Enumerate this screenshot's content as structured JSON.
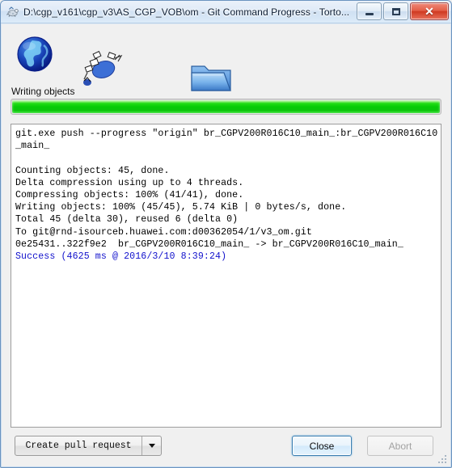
{
  "window": {
    "title": "D:\\cgp_v161\\cgp_v3\\AS_CGP_VOB\\om - Git Command Progress - Torto...",
    "app_icon": "tortoisegit-icon",
    "controls": {
      "minimize_label": "Minimize",
      "maximize_label": "Maximize",
      "close_label": "Close"
    }
  },
  "animation": {
    "source_icon": "globe-icon",
    "transfer_icon": "file-transfer-icon",
    "destination_icon": "folder-icon",
    "status_label": "Writing objects"
  },
  "progress": {
    "percent": 100,
    "fill_color": "#0bc40b",
    "track_color": "#e8e8e8"
  },
  "console": {
    "output": "git.exe push --progress \"origin\" br_CGPV200R016C10_main_:br_CGPV200R016C10_main_\n\nCounting objects: 45, done.\nDelta compression using up to 4 threads.\nCompressing objects: 100% (41/41), done.\nWriting objects: 100% (45/45), 5.74 KiB | 0 bytes/s, done.\nTotal 45 (delta 30), reused 6 (delta 0)\nTo git@rnd-isourceb.huawei.com:d00362054/1/v3_om.git\n0e25431..322f9e2  br_CGPV200R016C10_main_ -> br_CGPV200R016C10_main_\n",
    "result_line": "Success (4625 ms @ 2016/3/10 8:39:24)",
    "result_color": "#1111cc"
  },
  "buttons": {
    "pull_request_label": "Create pull request",
    "pull_request_dropdown_icon": "chevron-down-icon",
    "close_label": "Close",
    "abort_label": "Abort"
  }
}
